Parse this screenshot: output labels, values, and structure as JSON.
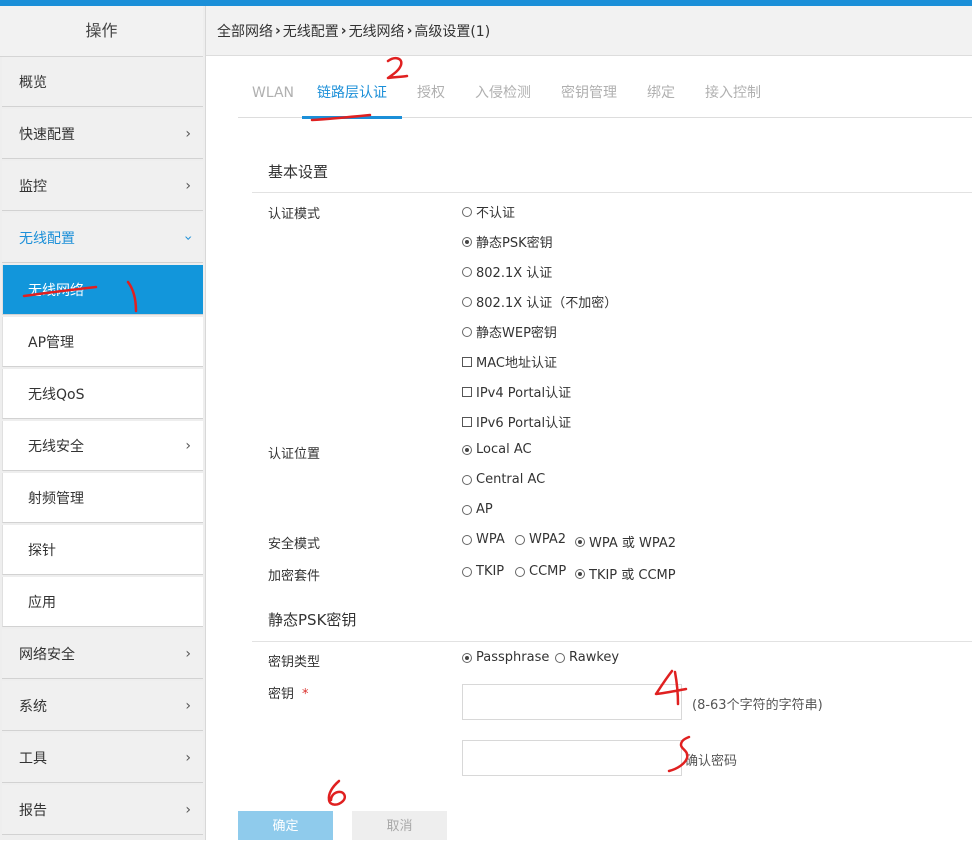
{
  "sidebar": {
    "header": "操作",
    "items": [
      {
        "label": "概览",
        "arrow": false
      },
      {
        "label": "快速配置",
        "arrow": true
      },
      {
        "label": "监控",
        "arrow": true
      },
      {
        "label": "无线配置",
        "arrow": true
      },
      {
        "label": "无线网络",
        "arrow": false
      },
      {
        "label": "AP管理",
        "arrow": false
      },
      {
        "label": "无线QoS",
        "arrow": false
      },
      {
        "label": "无线安全",
        "arrow": true
      },
      {
        "label": "射频管理",
        "arrow": false
      },
      {
        "label": "探针",
        "arrow": false
      },
      {
        "label": "应用",
        "arrow": false
      },
      {
        "label": "网络安全",
        "arrow": true
      },
      {
        "label": "系统",
        "arrow": true
      },
      {
        "label": "工具",
        "arrow": true
      },
      {
        "label": "报告",
        "arrow": true
      }
    ],
    "chevron": "›"
  },
  "breadcrumb": [
    "全部网络",
    "无线配置",
    "无线网络",
    "高级设置(1)"
  ],
  "breadcrumb_sep": "›",
  "tabs": [
    "WLAN",
    "链路层认证",
    "授权",
    "入侵检测",
    "密钥管理",
    "绑定",
    "接入控制"
  ],
  "basic": {
    "title": "基本设置",
    "auth_mode_label": "认证模式",
    "auth_modes": [
      {
        "label": "不认证",
        "type": "radio",
        "checked": false
      },
      {
        "label": "静态PSK密钥",
        "type": "radio",
        "checked": true
      },
      {
        "label": "802.1X 认证",
        "type": "radio",
        "checked": false
      },
      {
        "label": "802.1X 认证（不加密）",
        "type": "radio",
        "checked": false
      },
      {
        "label": "静态WEP密钥",
        "type": "radio",
        "checked": false
      },
      {
        "label": "MAC地址认证",
        "type": "checkbox",
        "checked": false
      },
      {
        "label": "IPv4 Portal认证",
        "type": "checkbox",
        "checked": false
      },
      {
        "label": "IPv6 Portal认证",
        "type": "checkbox",
        "checked": false
      }
    ],
    "auth_location_label": "认证位置",
    "auth_locations": [
      {
        "label": "Local AC",
        "checked": true
      },
      {
        "label": "Central AC",
        "checked": false
      },
      {
        "label": "AP",
        "checked": false
      }
    ],
    "security_mode_label": "安全模式",
    "security_modes": [
      {
        "label": "WPA",
        "checked": false
      },
      {
        "label": "WPA2",
        "checked": false
      },
      {
        "label": "WPA 或 WPA2",
        "checked": true
      }
    ],
    "cipher_label": "加密套件",
    "ciphers": [
      {
        "label": "TKIP",
        "checked": false
      },
      {
        "label": "CCMP",
        "checked": false
      },
      {
        "label": "TKIP 或 CCMP",
        "checked": true
      }
    ]
  },
  "psk": {
    "title": "静态PSK密钥",
    "key_type_label": "密钥类型",
    "key_types": [
      {
        "label": "Passphrase",
        "checked": true
      },
      {
        "label": "Rawkey",
        "checked": false
      }
    ],
    "key_label": "密钥",
    "required_mark": "*",
    "key_value": "",
    "key_hint": "(8-63个字符的字符串)",
    "confirm_value": "",
    "confirm_hint": "确认密码"
  },
  "buttons": {
    "ok": "确定",
    "cancel": "取消"
  },
  "colors": {
    "accent": "#1b8fd8",
    "annotation": "#e02020"
  }
}
